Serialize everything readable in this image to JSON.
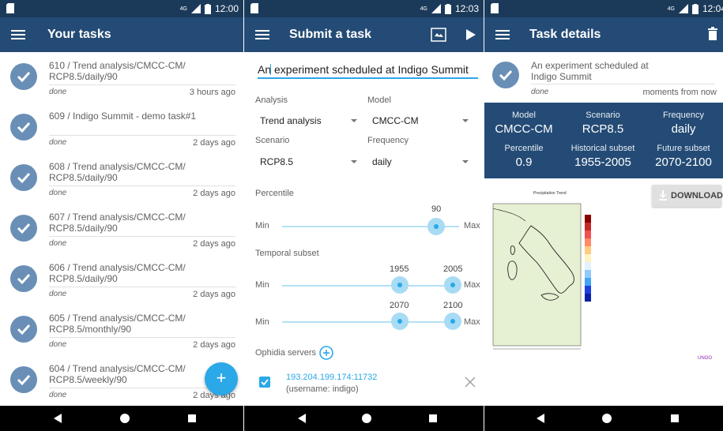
{
  "status_bar": {
    "time_1": "12:00",
    "time_2": "12:03",
    "time_3": "12:04",
    "network": "4G"
  },
  "screen1": {
    "title": "Your tasks",
    "tasks": [
      {
        "title": "610 / Trend analysis/CMCC-CM/ RCP8.5/daily/90",
        "status": "done",
        "time": "3 hours ago"
      },
      {
        "title": "609 / Indigo Summit - demo task#1",
        "status": "done",
        "time": "2 days ago"
      },
      {
        "title": "608 / Trend analysis/CMCC-CM/ RCP8.5/daily/90",
        "status": "done",
        "time": "2 days ago"
      },
      {
        "title": "607 / Trend analysis/CMCC-CM/ RCP8.5/daily/90",
        "status": "done",
        "time": "2 days ago"
      },
      {
        "title": "606 / Trend analysis/CMCC-CM/ RCP8.5/daily/90",
        "status": "done",
        "time": "2 days ago"
      },
      {
        "title": "605 / Trend analysis/CMCC-CM/ RCP8.5/monthly/90",
        "status": "done",
        "time": "2 days ago"
      },
      {
        "title": "604 / Trend analysis/CMCC-CM/ RCP8.5/weekly/90",
        "status": "done",
        "time": "2 days ago"
      }
    ],
    "fab_label": "+"
  },
  "screen2": {
    "title": "Submit a task",
    "task_name": "An experiment scheduled at Indigo Summit",
    "analysis_label": "Analysis",
    "analysis_value": "Trend analysis",
    "model_label": "Model",
    "model_value": "CMCC-CM",
    "scenario_label": "Scenario",
    "scenario_value": "RCP8.5",
    "frequency_label": "Frequency",
    "frequency_value": "daily",
    "percentile_label": "Percentile",
    "percentile": {
      "value": 90,
      "min_label": "Min",
      "max_label": "Max"
    },
    "temporal_label": "Temporal subset",
    "historical": {
      "from": 1955,
      "to": 2005,
      "min_label": "Min",
      "max_label": "Max"
    },
    "future": {
      "from": 2070,
      "to": 2100,
      "min_label": "Min",
      "max_label": "Max"
    },
    "servers_label": "Ophidia servers",
    "server": {
      "address": "193.204.199.174:11732",
      "username": "(username: indigo)",
      "checked": true
    }
  },
  "screen3": {
    "title": "Task details",
    "task_title": "An experiment scheduled at Indigo Summit",
    "status": "done",
    "time": "moments from now",
    "stats": [
      {
        "key": "Model",
        "value": "CMCC-CM"
      },
      {
        "key": "Scenario",
        "value": "RCP8.5"
      },
      {
        "key": "Frequency",
        "value": "daily"
      },
      {
        "key": "Percentile",
        "value": "0.9"
      },
      {
        "key": "Historical subset",
        "value": "1955-2005"
      },
      {
        "key": "Future subset",
        "value": "2070-2100"
      }
    ],
    "download_label": "DOWNLOAD",
    "map_title": "Precipitation Trend"
  },
  "colors": {
    "appbar": "#244b75",
    "statusbar": "#1b3a5a",
    "accent": "#2aa8e8",
    "check": "#6a8fb6"
  }
}
